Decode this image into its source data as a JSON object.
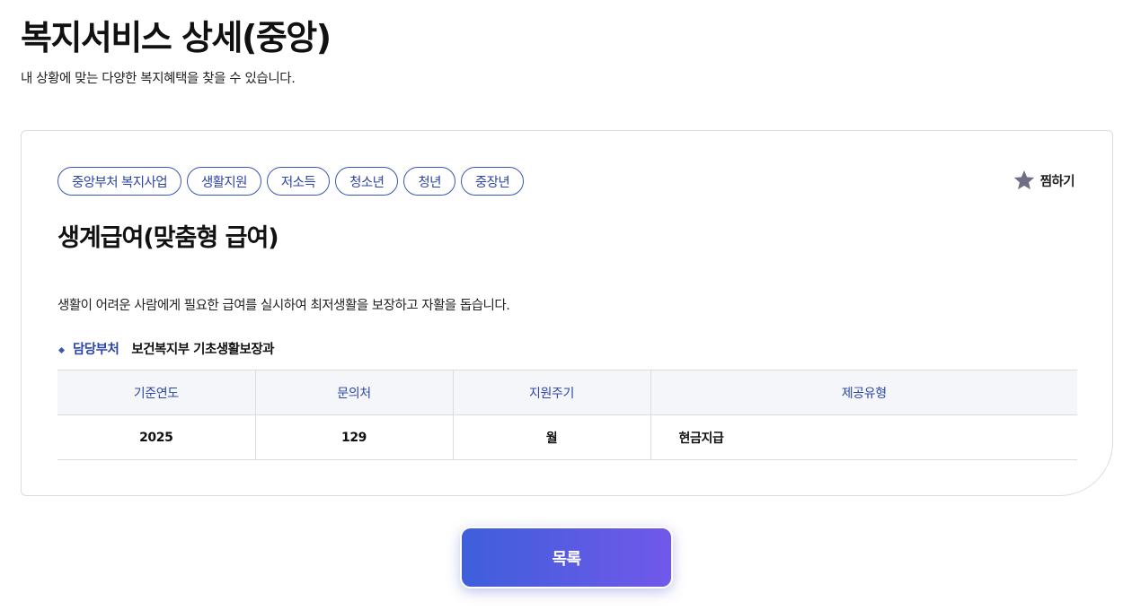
{
  "header": {
    "title": "복지서비스 상세(중앙)",
    "subtitle": "내 상황에 맞는 다양한 복지혜택을 찾을 수 있습니다."
  },
  "service": {
    "tags": [
      "중앙부처 복지사업",
      "생활지원",
      "저소득",
      "청소년",
      "청년",
      "중장년"
    ],
    "bookmark_label": "찜하기",
    "title": "생계급여(맞춤형 급여)",
    "description": "생활이 어려운 사람에게 필요한 급여를 실시하여 최저생활을 보장하고 자활을 돕습니다.",
    "department_label": "담당부처",
    "department_value": "보건복지부 기초생활보장과"
  },
  "table": {
    "headers": [
      "기준연도",
      "문의처",
      "지원주기",
      "제공유형"
    ],
    "row": [
      "2025",
      "129",
      "월",
      "현금지급"
    ]
  },
  "actions": {
    "list_label": "목록"
  },
  "colors": {
    "accent": "#2c46a8",
    "star": "#6e6e86",
    "button_start": "#3e5fdb",
    "button_end": "#7158ea"
  },
  "icons": {
    "bookmark": "star-icon",
    "department": "diamond-bullet-icon"
  }
}
